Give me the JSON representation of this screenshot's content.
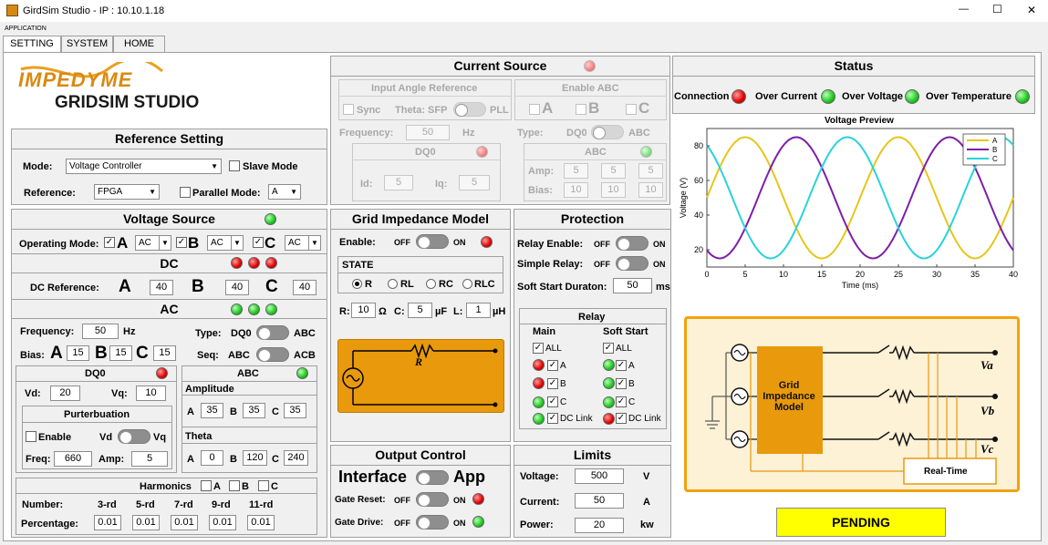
{
  "window": {
    "title": "GirdSim Studio - IP : 10.10.1.18",
    "minimize": "—",
    "maximize": "☐",
    "close": "✕"
  },
  "menu": {
    "label": "APPLICATION"
  },
  "tabs": [
    {
      "label": "SETTING"
    },
    {
      "label": "SYSTEM"
    },
    {
      "label": "HOME"
    }
  ],
  "logo": {
    "brand": "IMPEDYME",
    "product": "GRIDSIM STUDIO"
  },
  "reference": {
    "title": "Reference Setting",
    "mode_label": "Mode:",
    "mode_value": "Voltage Controller",
    "slave_label": "Slave Mode",
    "reference_label": "Reference:",
    "reference_value": "FPGA",
    "parallel_label": "Parallel Mode:",
    "parallel_value": "A"
  },
  "voltage_source": {
    "title": "Voltage Source",
    "op_mode_label": "Operating Mode:",
    "phases": [
      "A",
      "B",
      "C"
    ],
    "mode_values": [
      "AC",
      "AC",
      "AC"
    ],
    "dc_title": "DC",
    "dc_ref_label": "DC Reference:",
    "dc_values": [
      "40",
      "40",
      "40"
    ],
    "ac_title": "AC",
    "freq_label": "Frequency:",
    "freq_value": "50",
    "freq_unit": "Hz",
    "type_label": "Type:",
    "type_left": "DQ0",
    "type_right": "ABC",
    "bias_label": "Bias:",
    "bias_values": [
      "15",
      "15",
      "15"
    ],
    "seq_label": "Seq:",
    "seq_left": "ABC",
    "seq_right": "ACB"
  },
  "dq0": {
    "title": "DQ0",
    "vd_label": "Vd:",
    "vd_value": "20",
    "vq_label": "Vq:",
    "vq_value": "10",
    "pert_title": "Purterbuation",
    "enable_label": "Enable",
    "vd": "Vd",
    "vq": "Vq",
    "freq_label": "Freq:",
    "freq_value": "660",
    "amp_label": "Amp:",
    "amp_value": "5"
  },
  "abc": {
    "title": "ABC",
    "amp_title": "Amplitude",
    "amp_labels": [
      "A",
      "B",
      "C"
    ],
    "amp_values": [
      "35",
      "35",
      "35"
    ],
    "theta_title": "Theta",
    "theta_values": [
      "0",
      "120",
      "240"
    ]
  },
  "harmonics": {
    "title": "Harmonics",
    "phases": [
      "A",
      "B",
      "C"
    ],
    "number_label": "Number:",
    "percent_label": "Percentage:",
    "orders": [
      "3-rd",
      "5-rd",
      "7-rd",
      "9-rd",
      "11-rd"
    ],
    "values": [
      "0.01",
      "0.01",
      "0.01",
      "0.01",
      "0.01"
    ]
  },
  "current_source": {
    "title": "Current Source",
    "angle_title": "Input Angle Reference",
    "sync_label": "Sync",
    "theta_label": "Theta: SFP",
    "pll_label": "PLL",
    "enable_title": "Enable ABC",
    "phases": [
      "A",
      "B",
      "C"
    ],
    "freq_label": "Frequency:",
    "freq_value": "50",
    "freq_unit": "Hz",
    "type_label": "Type:",
    "type_left": "DQ0",
    "type_right": "ABC",
    "dq0_title": "DQ0",
    "id_label": "Id:",
    "id_value": "5",
    "iq_label": "Iq:",
    "iq_value": "5",
    "abc_title": "ABC",
    "amp_label": "Amp:",
    "amp_values": [
      "5",
      "5",
      "5"
    ],
    "bias_label": "Bias:",
    "bias_values": [
      "10",
      "10",
      "10"
    ]
  },
  "grid_impedance": {
    "title": "Grid Impedance Model",
    "enable_label": "Enable:",
    "off": "OFF",
    "on": "ON",
    "state_title": "STATE",
    "states": [
      "R",
      "RL",
      "RC",
      "RLC"
    ],
    "r_label": "R:",
    "r_value": "10",
    "r_unit": "Ω",
    "c_label": "C:",
    "c_value": "5",
    "c_unit": "µF",
    "l_label": "L:",
    "l_value": "1",
    "l_unit": "µH",
    "resistor_label": "R"
  },
  "protection": {
    "title": "Protection",
    "relay_enable_label": "Relay Enable:",
    "simple_relay_label": "Simple Relay:",
    "off": "OFF",
    "on": "ON",
    "soft_start_label": "Soft Start Duraton:",
    "soft_start_value": "50",
    "soft_start_unit": "ms",
    "relay_title": "Relay",
    "main_label": "Main",
    "soft_label": "Soft Start",
    "rows": [
      "ALL",
      "A",
      "B",
      "C",
      "DC Link"
    ]
  },
  "output_control": {
    "title": "Output Control",
    "interface_label": "Interface",
    "app_label": "App",
    "gate_reset_label": "Gate Reset:",
    "gate_drive_label": "Gate Drive:",
    "off": "OFF",
    "on": "ON"
  },
  "limits": {
    "title": "Limits",
    "voltage_label": "Voltage:",
    "voltage_value": "500",
    "voltage_unit": "V",
    "current_label": "Current:",
    "current_value": "50",
    "current_unit": "A",
    "power_label": "Power:",
    "power_value": "20",
    "power_unit": "kw"
  },
  "status": {
    "title": "Status",
    "items": [
      "Connection",
      "Over Current",
      "Over Voltage",
      "Over Temperature"
    ],
    "pending": "PENDING"
  },
  "diagram": {
    "block_label": "Grid Impedance Model",
    "realtime_label": "Real-Time",
    "va": "Va",
    "vb": "Vb",
    "vc": "Vc"
  },
  "chart_data": {
    "type": "line",
    "title": "Voltage Preview",
    "xlabel": "Time (ms)",
    "ylabel": "Voltage (V)",
    "xlim": [
      0,
      40
    ],
    "ylim": [
      10,
      90
    ],
    "xticks": [
      0,
      5,
      10,
      15,
      20,
      25,
      30,
      35,
      40
    ],
    "yticks": [
      20,
      40,
      60,
      80
    ],
    "series": [
      {
        "name": "A",
        "color": "#e6c619",
        "offset": 50,
        "amplitude": 35,
        "phase_deg": 0
      },
      {
        "name": "B",
        "color": "#7d1fa8",
        "offset": 50,
        "amplitude": 35,
        "phase_deg": -120
      },
      {
        "name": "C",
        "color": "#29d3d8",
        "offset": 50,
        "amplitude": 35,
        "phase_deg": 120
      }
    ],
    "frequency_hz": 50,
    "legend": "top-right",
    "grid": false
  }
}
